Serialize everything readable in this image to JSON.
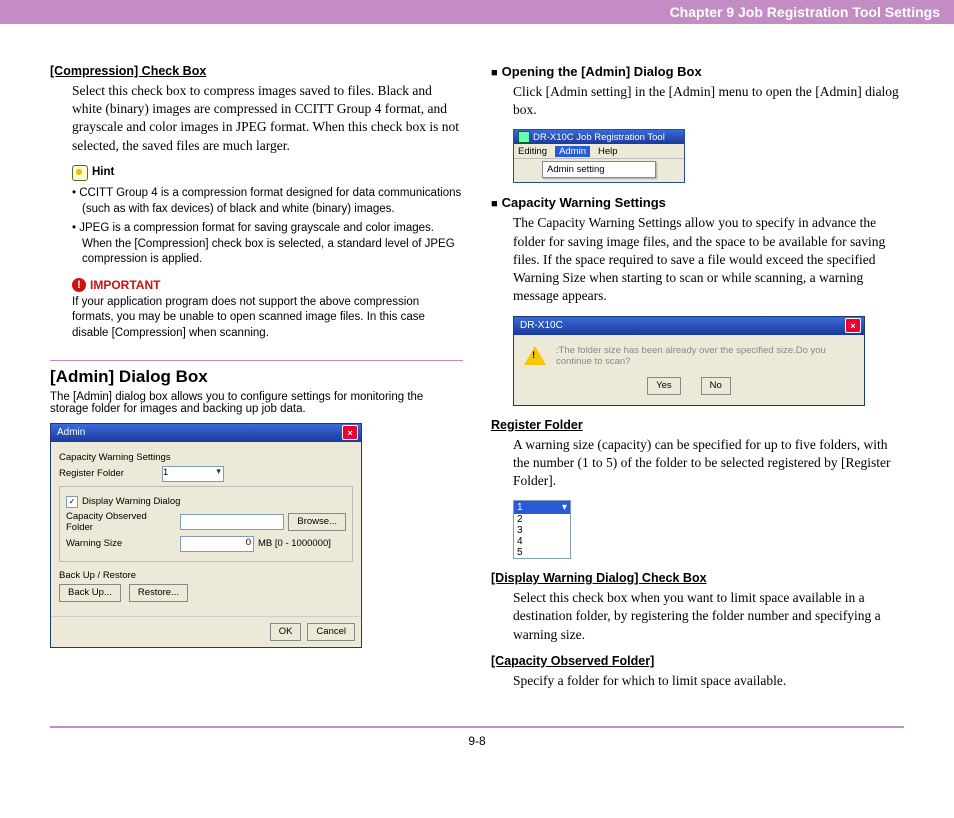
{
  "header": "Chapter 9   Job Registration Tool Settings",
  "left": {
    "h_compression": "[Compression] Check Box",
    "p_compression": "Select this check box to compress images saved to files. Black and white (binary) images are compressed in CCITT Group 4 format, and grayscale and color images in JPEG format. When this check box is not selected, the saved files are much larger.",
    "hint_label": "Hint",
    "hint_items": [
      "CCITT Group 4 is a compression format designed for data communications (such as with fax devices) of black and white (binary) images.",
      "JPEG is a compression format for saving grayscale and color images. When the [Compression] check box is selected, a standard level of JPEG compression is applied."
    ],
    "important_label": "IMPORTANT",
    "important_text": "If your application program does not support the above compression formats, you may be unable to open scanned image files. In this case disable [Compression] when scanning.",
    "section_title": "[Admin] Dialog Box",
    "section_desc": "The [Admin] dialog box allows you to configure settings for monitoring the storage folder for images and backing up job data.",
    "dlg": {
      "title": "Admin",
      "cap_label": "Capacity Warning Settings",
      "reg_label": "Register Folder",
      "reg_value": "1",
      "chk_label": "Display Warning Dialog",
      "obs_label": "Capacity Observed Folder",
      "browse": "Browse...",
      "warn_label": "Warning Size",
      "warn_value": "0",
      "warn_unit": "MB [0 - 1000000]",
      "bur_label": "Back Up / Restore",
      "backup": "Back Up...",
      "restore": "Restore...",
      "ok": "OK",
      "cancel": "Cancel"
    }
  },
  "right": {
    "h_open": "Opening the [Admin] Dialog Box",
    "p_open": "Click [Admin setting] in the [Admin] menu to open the [Admin] dialog box.",
    "menu": {
      "title": "DR-X10C Job Registration Tool",
      "items": [
        "Editing",
        "Admin",
        "Help"
      ],
      "drop": "Admin setting"
    },
    "h_cap": "Capacity Warning Settings",
    "p_cap": "The Capacity Warning Settings allow you to specify in advance the folder for saving image files, and the space to be available for saving files. If the space required to save a file would exceed the specified Warning Size when starting to scan or while scanning, a warning message appears.",
    "warn_dlg": {
      "title": "DR-X10C",
      "msg": ":The folder size has been already over the specified size.Do you continue to scan?",
      "yes": "Yes",
      "no": "No"
    },
    "h_reg": "Register Folder",
    "p_reg": "A warning size (capacity) can be specified for up to five folders, with the number (1 to 5) of the folder to be selected registered by [Register Folder].",
    "rf_options": [
      "1",
      "2",
      "3",
      "4",
      "5"
    ],
    "h_dwd": "[Display Warning Dialog] Check Box",
    "p_dwd": "Select this check box when you want to limit space available in a destination folder, by registering the folder number and specifying a warning size.",
    "h_cof": "[Capacity Observed Folder]",
    "p_cof": "Specify a folder for which to limit space available."
  },
  "footer": "9-8"
}
